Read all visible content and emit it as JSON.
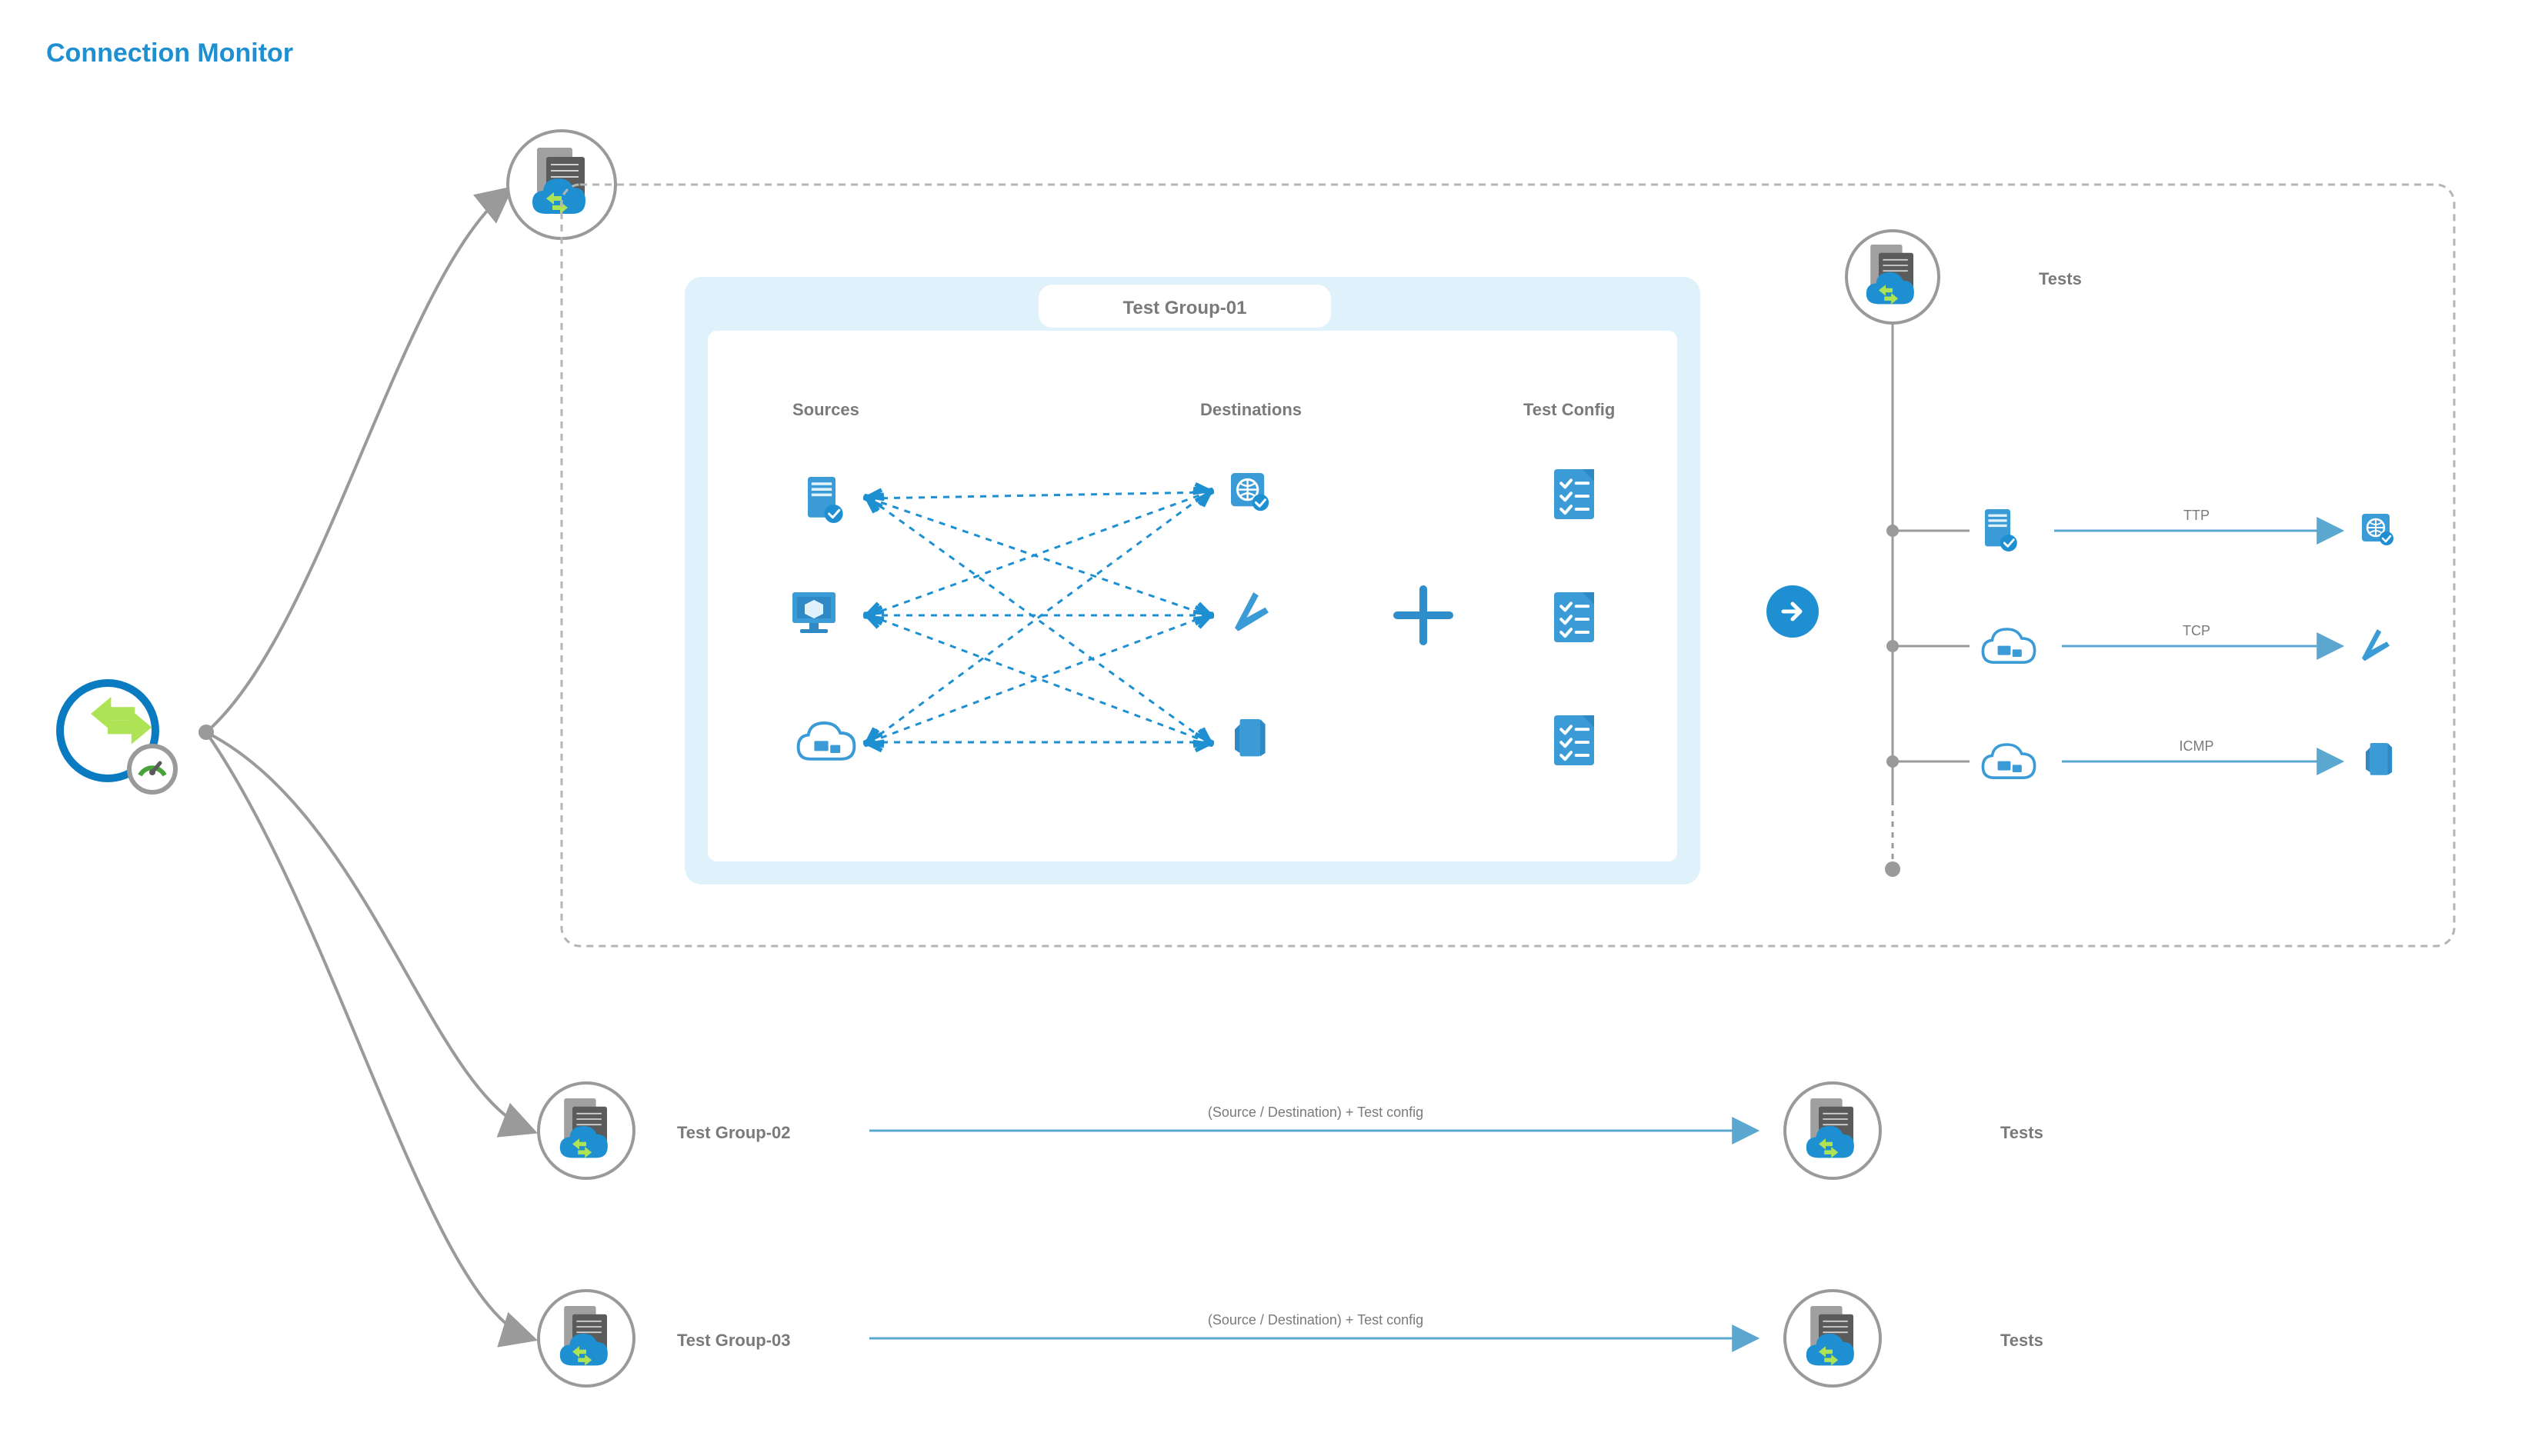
{
  "title": "Connection Monitor",
  "testGroup1": {
    "tab": "Test Group-01",
    "cols": {
      "sources": "Sources",
      "destinations": "Destinations",
      "testconfig": "Test Config"
    }
  },
  "testsHeader": "Tests",
  "testLines": [
    "TTP",
    "TCP",
    "ICMP"
  ],
  "group2": {
    "label": "Test Group-02",
    "arrow": "(Source / Destination) + Test config",
    "tests": "Tests"
  },
  "group3": {
    "label": "Test Group-03",
    "arrow": "(Source / Destination) + Test config",
    "tests": "Tests"
  },
  "colors": {
    "brandBlue": "#1e90d2",
    "lightBlue": "#dff2fb",
    "gray": "#7a7a7a",
    "green": "#aee356"
  }
}
